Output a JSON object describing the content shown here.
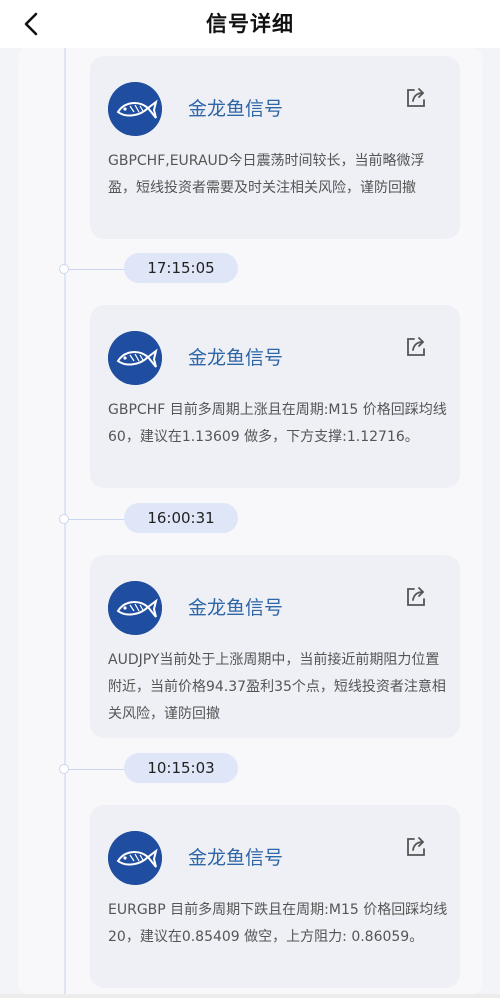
{
  "header": {
    "title": "信号详细",
    "back_icon": "chevron-left-icon"
  },
  "messages": [
    {
      "sender": "金龙鱼信号",
      "text": "GBPCHF,EURAUD今日震荡时间较长，当前略微浮盈，短线投资者需要及时关注相关风险，谨防回撤",
      "avatar_icon": "fish-logo-icon",
      "share_icon": "share-icon"
    },
    {
      "time": "17:15:05",
      "sender": "金龙鱼信号",
      "text": "GBPCHF 目前多周期上涨且在周期:M15 价格回踩均线60，建议在1.13609 做多，下方支撑:1.12716。",
      "avatar_icon": "fish-logo-icon",
      "share_icon": "share-icon"
    },
    {
      "time": "16:00:31",
      "sender": "金龙鱼信号",
      "text": "AUDJPY当前处于上涨周期中，当前接近前期阻力位置附近，当前价格94.37盈利35个点，短线投资者注意相关风险，谨防回撤",
      "avatar_icon": "fish-logo-icon",
      "share_icon": "share-icon"
    },
    {
      "time": "10:15:03",
      "sender": "金龙鱼信号",
      "text": "EURGBP 目前多周期下跌且在周期:M15 价格回踩均线20，建议在0.85409 做空，上方阻力: 0.86059。",
      "avatar_icon": "fish-logo-icon",
      "share_icon": "share-icon"
    }
  ],
  "colors": {
    "accent": "#2f66a8",
    "avatar_bg": "#1f4da0",
    "time_pill": "#dfe6f7",
    "card_bg": "#eef0f5"
  }
}
